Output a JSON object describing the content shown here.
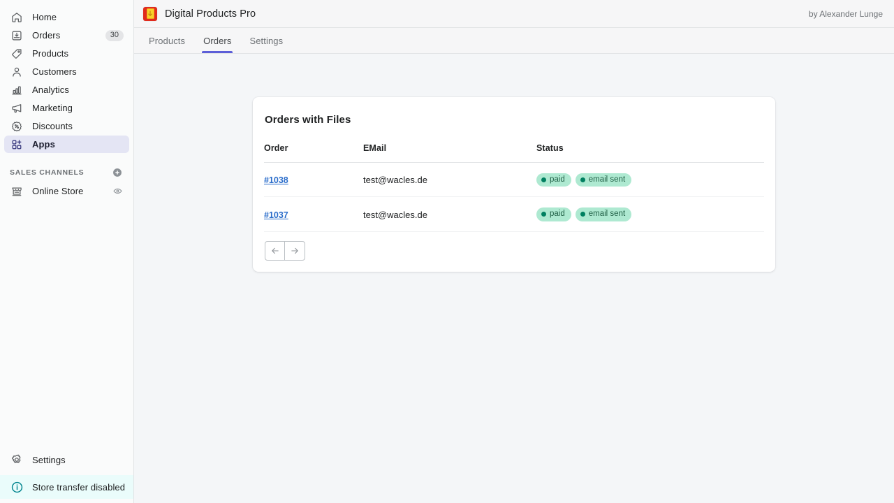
{
  "sidebar": {
    "nav": [
      {
        "label": "Home",
        "icon": "home-icon",
        "badge": null,
        "active": false
      },
      {
        "label": "Orders",
        "icon": "orders-icon",
        "badge": "30",
        "active": false
      },
      {
        "label": "Products",
        "icon": "products-tag-icon",
        "badge": null,
        "active": false
      },
      {
        "label": "Customers",
        "icon": "customers-icon",
        "badge": null,
        "active": false
      },
      {
        "label": "Analytics",
        "icon": "analytics-icon",
        "badge": null,
        "active": false
      },
      {
        "label": "Marketing",
        "icon": "marketing-megaphone-icon",
        "badge": null,
        "active": false
      },
      {
        "label": "Discounts",
        "icon": "discounts-percent-icon",
        "badge": null,
        "active": false
      },
      {
        "label": "Apps",
        "icon": "apps-grid-icon",
        "badge": null,
        "active": true
      }
    ],
    "sales_channels": {
      "title": "SALES CHANNELS",
      "add_icon": "plus-circle-icon",
      "items": [
        {
          "label": "Online Store",
          "icon": "online-store-icon",
          "trailing_icon": "eye-icon"
        }
      ]
    },
    "footer": {
      "settings": {
        "label": "Settings",
        "icon": "gear-icon"
      },
      "notice": {
        "label": "Store transfer disabled",
        "icon": "info-circle-icon"
      }
    },
    "active_accent": "#e4e5f4"
  },
  "topbar": {
    "app_icon": "digital-products-pro-app-icon",
    "title": "Digital Products Pro",
    "byline": "by Alexander Lunge"
  },
  "tabs": [
    {
      "label": "Products",
      "active": false
    },
    {
      "label": "Orders",
      "active": true
    },
    {
      "label": "Settings",
      "active": false
    }
  ],
  "card": {
    "title": "Orders with Files",
    "table": {
      "columns": [
        "Order",
        "EMail",
        "Status"
      ],
      "rows": [
        {
          "order": "#1038",
          "email": "test@wacles.de",
          "status": [
            {
              "label": "paid",
              "dot_color": "#008060"
            },
            {
              "label": "email sent",
              "dot_color": "#008060"
            }
          ]
        },
        {
          "order": "#1037",
          "email": "test@wacles.de",
          "status": [
            {
              "label": "paid",
              "dot_color": "#008060"
            },
            {
              "label": "email sent",
              "dot_color": "#008060"
            }
          ]
        }
      ]
    },
    "pagination": {
      "prev_icon": "arrow-left-icon",
      "next_icon": "arrow-right-icon"
    }
  },
  "colors": {
    "tab_underline": "#5c5fd8",
    "link": "#2c6ecb",
    "badge_bg": "#aee9d1",
    "badge_text": "#1f5f45",
    "notice_bg": "#eafcfb",
    "notice_icon": "#00848e",
    "page_bg": "#f4f6f8"
  }
}
